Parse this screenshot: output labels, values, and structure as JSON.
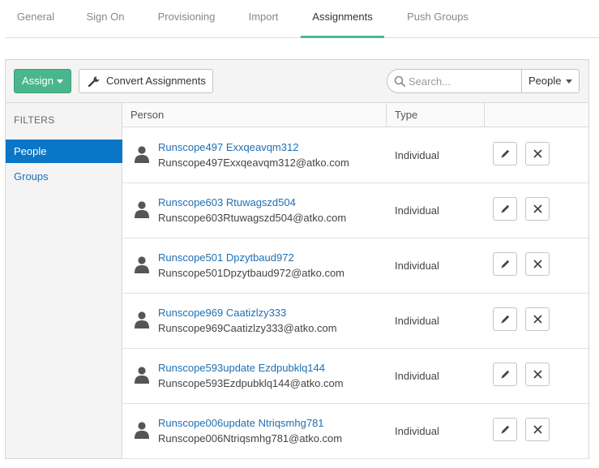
{
  "tabs": [
    {
      "label": "General"
    },
    {
      "label": "Sign On"
    },
    {
      "label": "Provisioning"
    },
    {
      "label": "Import"
    },
    {
      "label": "Assignments",
      "active": true
    },
    {
      "label": "Push Groups"
    }
  ],
  "toolbar": {
    "assign_label": "Assign",
    "convert_label": "Convert Assignments",
    "search_placeholder": "Search...",
    "search_value": "",
    "filter_select_value": "People"
  },
  "sidebar": {
    "title": "FILTERS",
    "items": [
      {
        "label": "People",
        "active": true
      },
      {
        "label": "Groups"
      }
    ]
  },
  "table": {
    "columns": [
      "Person",
      "Type",
      ""
    ],
    "rows": [
      {
        "name": "Runscope497 Exxqeavqm312",
        "email": "Runscope497Exxqeavqm312@atko.com",
        "type": "Individual"
      },
      {
        "name": "Runscope603 Rtuwagszd504",
        "email": "Runscope603Rtuwagszd504@atko.com",
        "type": "Individual"
      },
      {
        "name": "Runscope501 Dpzytbaud972",
        "email": "Runscope501Dpzytbaud972@atko.com",
        "type": "Individual"
      },
      {
        "name": "Runscope969 Caatizlzy333",
        "email": "Runscope969Caatizlzy333@atko.com",
        "type": "Individual"
      },
      {
        "name": "Runscope593update Ezdpubklq144",
        "email": "Runscope593Ezdpubklq144@atko.com",
        "type": "Individual"
      },
      {
        "name": "Runscope006update Ntriqsmhg781",
        "email": "Runscope006Ntriqsmhg781@atko.com",
        "type": "Individual"
      }
    ]
  },
  "icons": {
    "wrench": "wrench-icon",
    "search": "search-icon",
    "avatar": "person-icon",
    "edit": "pencil-icon",
    "remove": "close-icon"
  },
  "colors": {
    "accent_green": "#49b68d",
    "link_blue": "#1f6fb2",
    "active_filter_blue": "#0a76c7"
  }
}
